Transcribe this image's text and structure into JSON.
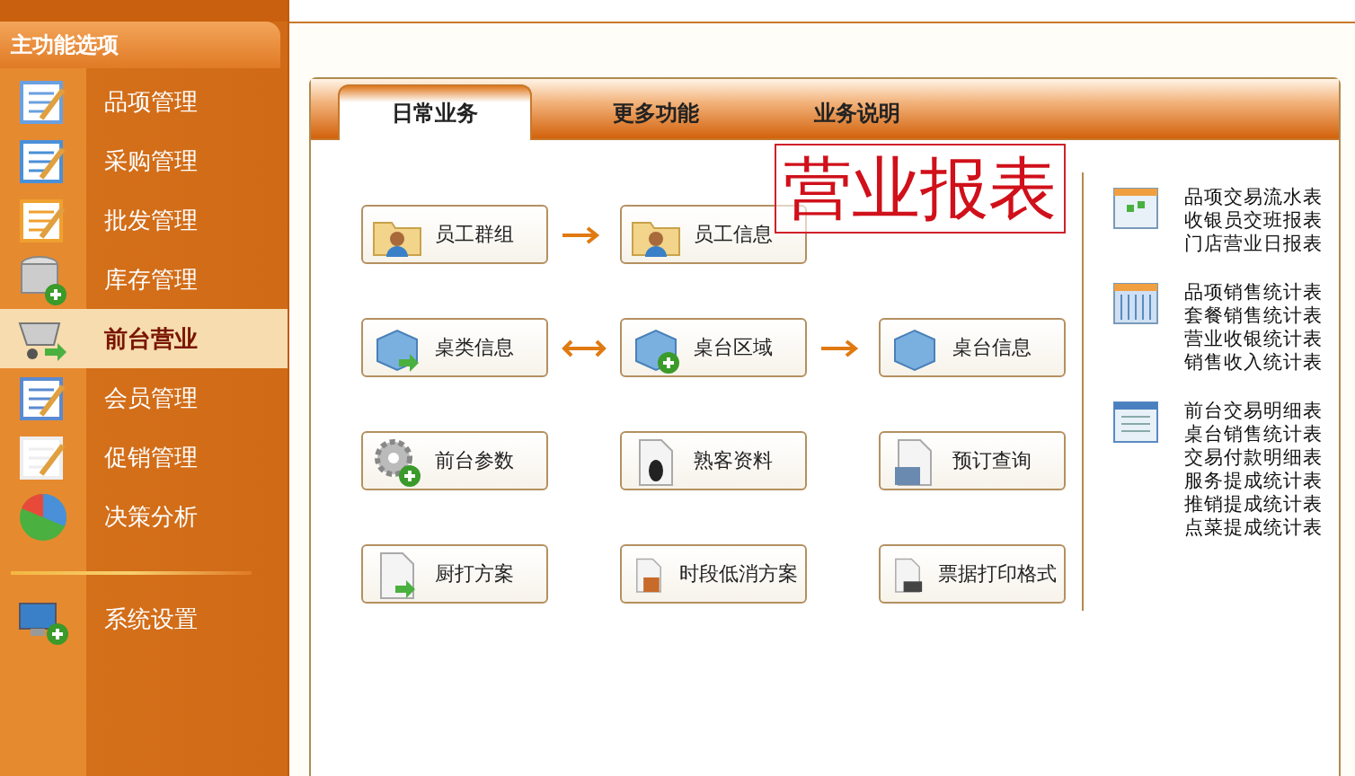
{
  "sidebar": {
    "title": "主功能选项",
    "items": [
      {
        "label": "品项管理",
        "selected": false
      },
      {
        "label": "采购管理",
        "selected": false
      },
      {
        "label": "批发管理",
        "selected": false
      },
      {
        "label": "库存管理",
        "selected": false
      },
      {
        "label": "前台营业",
        "selected": true
      },
      {
        "label": "会员管理",
        "selected": false
      },
      {
        "label": "促销管理",
        "selected": false
      },
      {
        "label": "决策分析",
        "selected": false
      }
    ],
    "bottom_items": [
      {
        "label": "系统设置",
        "selected": false
      }
    ]
  },
  "tabs": [
    {
      "label": "日常业务",
      "selected": true
    },
    {
      "label": "更多功能",
      "selected": false
    },
    {
      "label": "业务说明",
      "selected": false
    }
  ],
  "stamp": "营业报表",
  "flow_rows": [
    {
      "items": [
        {
          "kind": "button",
          "label": "员工群组"
        },
        {
          "kind": "arrow_right"
        },
        {
          "kind": "button",
          "label": "员工信息"
        },
        {
          "kind": "gap"
        },
        {
          "kind": "gap"
        }
      ]
    },
    {
      "items": [
        {
          "kind": "button",
          "label": "桌类信息"
        },
        {
          "kind": "arrow_both"
        },
        {
          "kind": "button",
          "label": "桌台区域"
        },
        {
          "kind": "arrow_right"
        },
        {
          "kind": "button",
          "label": "桌台信息"
        }
      ]
    },
    {
      "items": [
        {
          "kind": "button",
          "label": "前台参数"
        },
        {
          "kind": "gap"
        },
        {
          "kind": "button",
          "label": "熟客资料"
        },
        {
          "kind": "gap"
        },
        {
          "kind": "button",
          "label": "预订查询"
        }
      ]
    },
    {
      "items": [
        {
          "kind": "button",
          "label": "厨打方案"
        },
        {
          "kind": "gap"
        },
        {
          "kind": "button",
          "label": "时段低消方案"
        },
        {
          "kind": "gap"
        },
        {
          "kind": "button",
          "label": "票据打印格式"
        }
      ]
    }
  ],
  "report_groups": [
    {
      "kind": "calendar",
      "items": [
        "品项交易流水表",
        "收银员交班报表",
        "门店营业日报表"
      ]
    },
    {
      "kind": "columns",
      "items": [
        "品项销售统计表",
        "套餐销售统计表",
        "营业收银统计表",
        "销售收入统计表"
      ]
    },
    {
      "kind": "list",
      "items": [
        "前台交易明细表",
        "桌台销售统计表",
        "交易付款明细表",
        "服务提成统计表",
        "推销提成统计表",
        "点菜提成统计表"
      ]
    }
  ]
}
